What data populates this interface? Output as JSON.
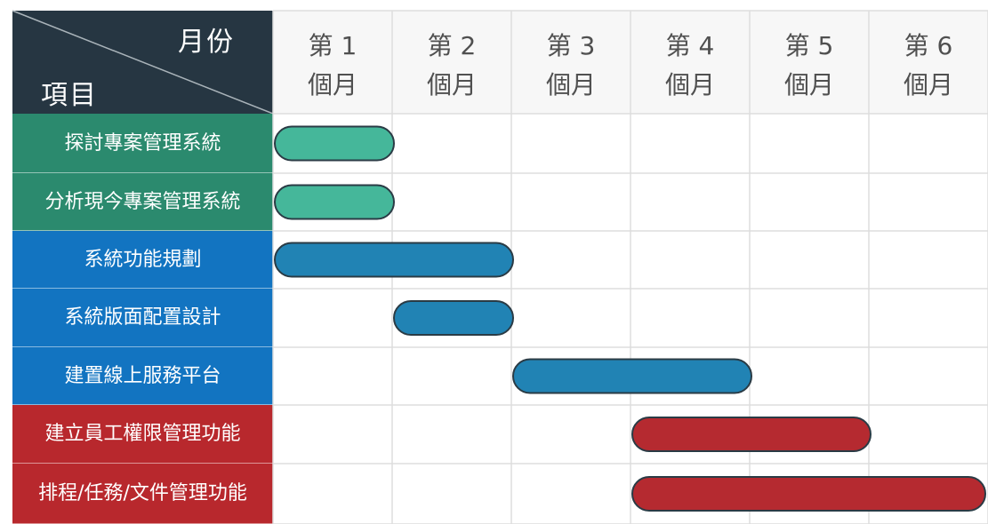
{
  "header": {
    "corner_top": "月份",
    "corner_bottom": "項目"
  },
  "colors": {
    "corner_bg": "#263642",
    "header_bg": "#f7f7f7",
    "grid_line": "#dddddd",
    "green_label": "#2b8a6e",
    "green_bar": "#45b79a",
    "blue_label": "#1274c1",
    "blue_bar": "#2183b4",
    "red_label": "#b8282d",
    "red_bar": "#b52a30",
    "bar_stroke": "#2a3b45"
  },
  "chart_data": {
    "type": "gantt",
    "time_unit": "月",
    "periods": [
      {
        "top": "第 1",
        "bottom": "個月"
      },
      {
        "top": "第 2",
        "bottom": "個月"
      },
      {
        "top": "第 3",
        "bottom": "個月"
      },
      {
        "top": "第 4",
        "bottom": "個月"
      },
      {
        "top": "第 5",
        "bottom": "個月"
      },
      {
        "top": "第 6",
        "bottom": "個月"
      }
    ],
    "tasks": [
      {
        "label": "探討專案管理系統",
        "group": "green",
        "start": 0,
        "end": 1
      },
      {
        "label": "分析現今專案管理系統",
        "group": "green",
        "start": 0,
        "end": 1
      },
      {
        "label": "系統功能規劃",
        "group": "blue",
        "start": 0,
        "end": 2
      },
      {
        "label": "系統版面配置設計",
        "group": "blue",
        "start": 1,
        "end": 2
      },
      {
        "label": "建置線上服務平台",
        "group": "blue",
        "start": 2,
        "end": 4
      },
      {
        "label": "建立員工權限管理功能",
        "group": "red",
        "start": 3,
        "end": 5
      },
      {
        "label": "排程/任務/文件管理功能",
        "group": "red",
        "start": 3,
        "end": 6
      }
    ]
  }
}
